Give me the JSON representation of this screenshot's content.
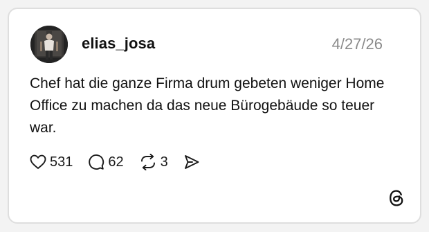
{
  "post": {
    "username": "elias_josa",
    "date": "4/27/26",
    "text": "Chef hat die ganze Firma drum gebeten weniger Home Office zu machen da das neue Bürogebäude so teuer war.",
    "likes": "531",
    "replies": "62",
    "reposts": "3"
  },
  "icons": {
    "like": "heart-icon",
    "reply": "speech-bubble-icon",
    "repost": "repost-arrows-icon",
    "share": "send-icon",
    "brand": "threads-logo-icon"
  },
  "colors": {
    "background": "#f3f3f3",
    "card": "#ffffff",
    "border": "#dedede",
    "date": "#8a8a8a",
    "text": "#111111"
  }
}
